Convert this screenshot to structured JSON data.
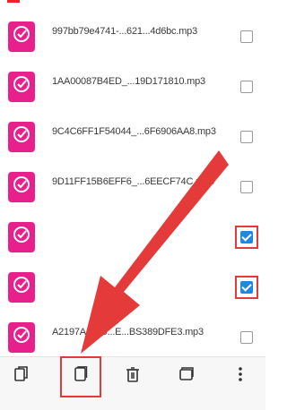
{
  "colors": {
    "accent": "#e5262c",
    "app_icon": "#e8208c",
    "checkbox_checked": "#1e88e5",
    "highlight": "#e23a3a"
  },
  "files": [
    {
      "name": "997bb79e4741-...621...4d6bc.mp3",
      "meta": "",
      "checked": false,
      "icon": "music-app-icon"
    },
    {
      "name": "1AA00087B4ED_...19D171810.mp3",
      "meta": "",
      "checked": false,
      "icon": "music-app-icon"
    },
    {
      "name": "9C4C6FF1F54044_...6F6906AA8.mp3",
      "meta": "",
      "checked": false,
      "icon": "music-app-icon"
    },
    {
      "name": "9D11FF15B6EFF6_...6EECF74C.mp3",
      "meta": "",
      "checked": false,
      "icon": "music-app-icon"
    },
    {
      "name": "",
      "meta": "",
      "checked": true,
      "icon": "music-app-icon"
    },
    {
      "name": "",
      "meta": "",
      "checked": true,
      "icon": "music-app-icon"
    },
    {
      "name": "A2197A4609...E...BS389DFE3.mp3",
      "meta": "",
      "checked": false,
      "icon": "music-app-icon"
    }
  ],
  "bottom_bar": [
    {
      "key": "copy",
      "label": "",
      "icon": "copy-icon"
    },
    {
      "key": "move",
      "label": "",
      "icon": "document-icon"
    },
    {
      "key": "delete",
      "label": "",
      "icon": "trash-icon"
    },
    {
      "key": "share",
      "label": "",
      "icon": "share-icon"
    },
    {
      "key": "more",
      "label": "",
      "icon": "more-vertical-icon"
    }
  ]
}
